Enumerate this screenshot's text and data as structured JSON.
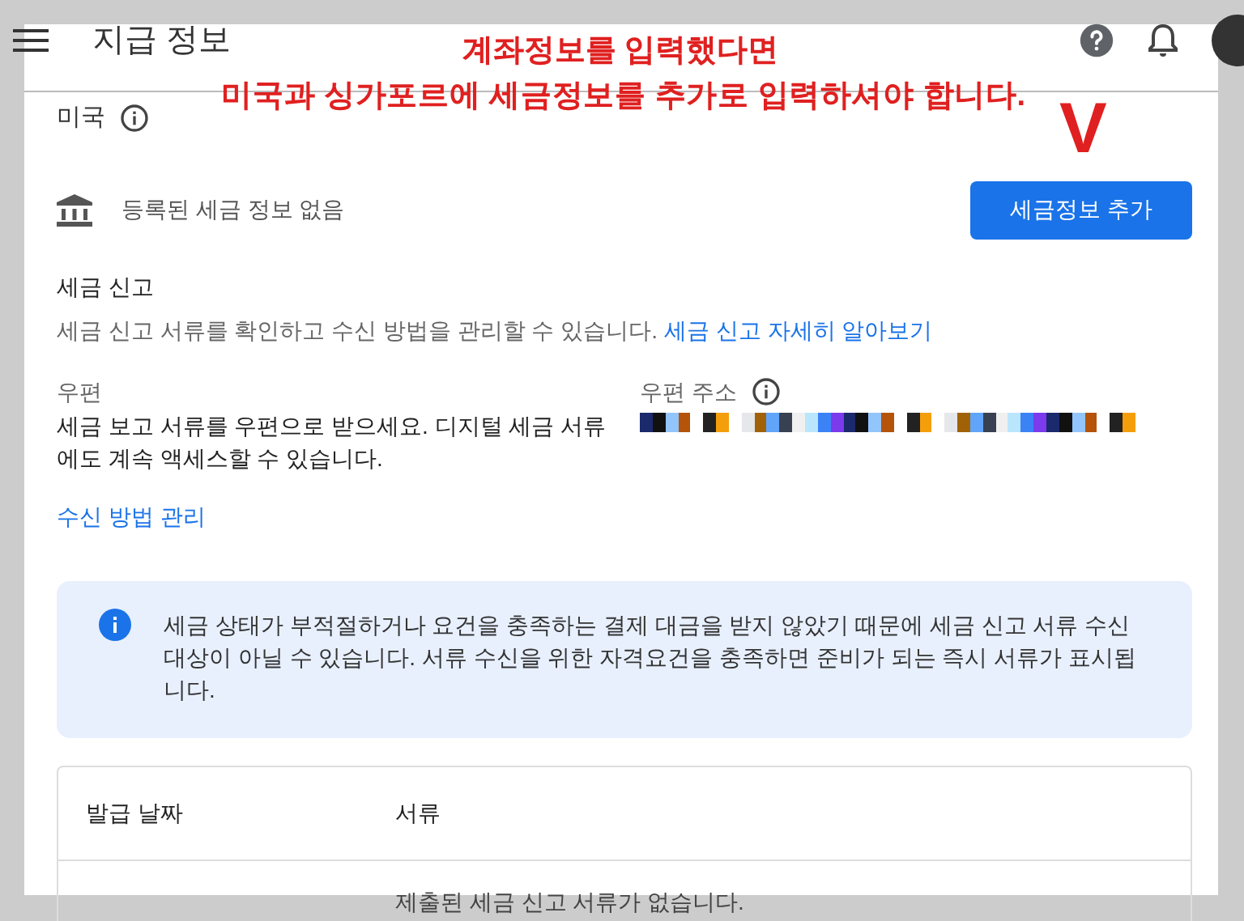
{
  "header": {
    "title": "지급 정보"
  },
  "annotation": {
    "lines": [
      "계좌정보를 입력했다면",
      "미국과 싱가포르에 세금정보를 추가로 입력하셔야 합니다."
    ],
    "mark": "V"
  },
  "country": {
    "name": "미국"
  },
  "tax_info": {
    "status": "등록된 세금 정보 없음",
    "button": "세금정보 추가"
  },
  "tax_filing": {
    "title": "세금 신고",
    "description": "세금 신고 서류를 확인하고 수신 방법을 관리할 수 있습니다.",
    "link": "세금 신고 자세히 알아보기"
  },
  "mail": {
    "label": "우편",
    "description": "세금 보고 서류를 우편으로 받으세요. 디지털 세금 서류에도 계속 액세스할 수 있습니다.",
    "address_label": "우편 주소",
    "manage_link": "수신 방법 관리"
  },
  "notice": "세금 상태가 부적절하거나 요건을 충족하는 결제 대금을 받지 않았기 때문에 세금 신고 서류 수신 대상이 아닐 수 있습니다. 서류 수신을 위한 자격요건을 충족하면 준비가 되는 즉시 서류가 표시됩니다.",
  "table": {
    "columns": [
      "발급 날짜",
      "서류"
    ],
    "empty_message": "제출된 세금 신고 서류가 없습니다."
  }
}
